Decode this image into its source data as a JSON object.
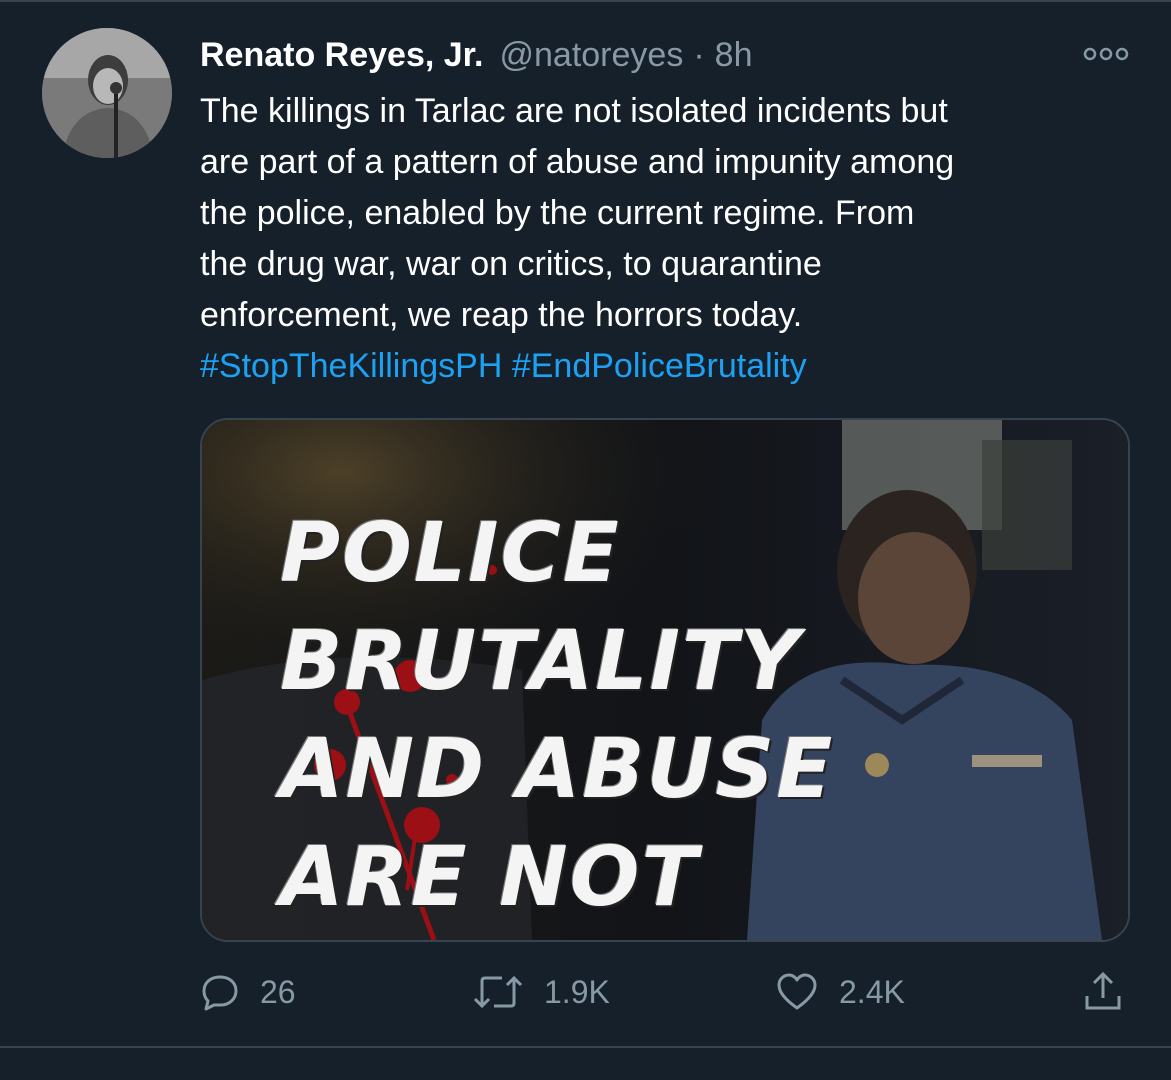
{
  "tweet": {
    "display_name": "Renato Reyes, Jr.",
    "handle": "@natoreyes",
    "separator": "·",
    "time": "8h",
    "text_lines": [
      "The killings in Tarlac are not isolated incidents but",
      "are part of a pattern of abuse and impunity among",
      "the police, enabled by the current regime. From",
      "the drug war, war on critics, to quarantine",
      "enforcement, we reap the horrors today."
    ],
    "hashtags": [
      "#StopTheKillingsPH",
      "#EndPoliceBrutality"
    ],
    "media": {
      "poster_lines": [
        "POLICE",
        "BRUTALITY",
        "AND ABUSE",
        "ARE NOT"
      ]
    },
    "actions": {
      "reply_count": "26",
      "retweet_count": "1.9K",
      "like_count": "2.4K"
    },
    "icons": {
      "more": "more-icon",
      "reply": "reply-icon",
      "retweet": "retweet-icon",
      "like": "heart-icon",
      "share": "share-icon"
    }
  },
  "colors": {
    "background": "#15202b",
    "text": "#ffffff",
    "secondary": "#8899a6",
    "link": "#1da1f2",
    "divider": "#38444d",
    "blood": "#9b0f15"
  }
}
